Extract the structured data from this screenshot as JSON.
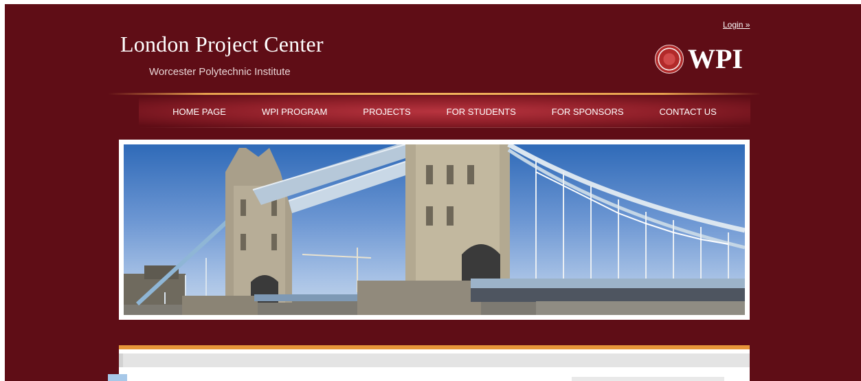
{
  "header": {
    "site_title": "London Project Center",
    "site_subtitle": "Worcester Polytechnic Institute",
    "login_label": "Login »",
    "logo_text": "WPI"
  },
  "nav": {
    "items": [
      {
        "label": "HOME PAGE"
      },
      {
        "label": "WPI PROGRAM"
      },
      {
        "label": "PROJECTS"
      },
      {
        "label": "FOR STUDENTS"
      },
      {
        "label": "FOR SPONSORS"
      },
      {
        "label": "CONTACT US"
      }
    ]
  },
  "colors": {
    "background": "#5f0d16",
    "nav_highlight": "#b8343f",
    "accent_orange": "#e8963a"
  }
}
